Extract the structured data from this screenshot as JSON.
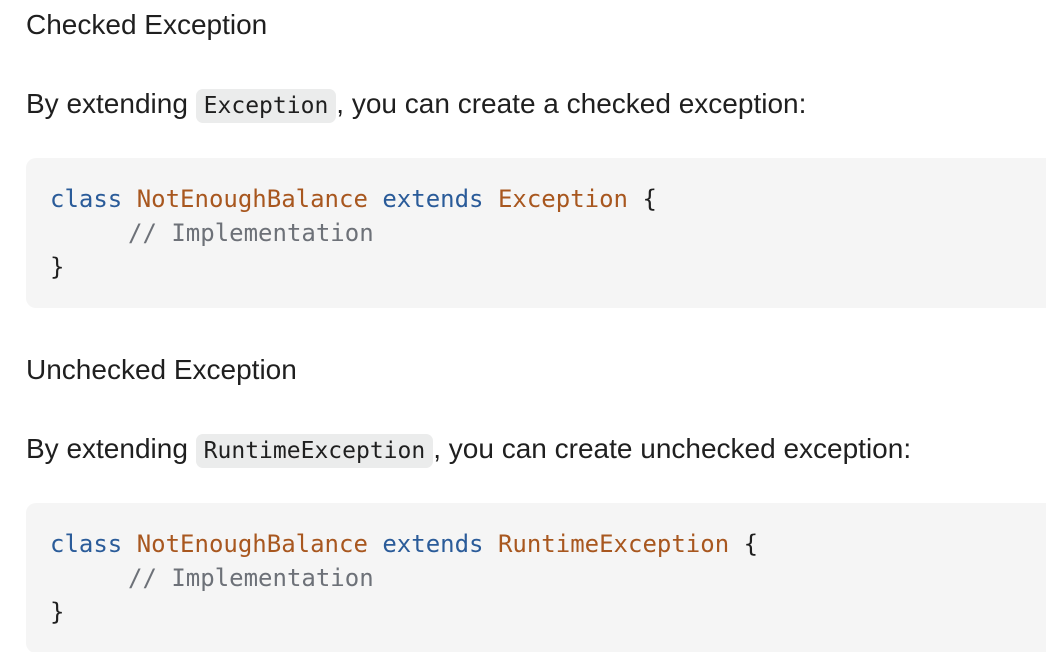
{
  "sections": [
    {
      "heading": "Checked Exception",
      "text_before": "By extending ",
      "inline_code": "Exception",
      "text_after": ", you can create a checked exception:",
      "code": {
        "kw_class": "class",
        "class_name": "NotEnoughBalance",
        "kw_extends": "extends",
        "parent": "Exception",
        "open_brace": "{",
        "comment": "// Implementation",
        "close_brace": "}"
      }
    },
    {
      "heading": "Unchecked Exception",
      "text_before": "By extending ",
      "inline_code": "RuntimeException",
      "text_after": ", you can create unchecked exception:",
      "code": {
        "kw_class": "class",
        "class_name": "NotEnoughBalance",
        "kw_extends": "extends",
        "parent": "RuntimeException",
        "open_brace": "{",
        "comment": "// Implementation",
        "close_brace": "}"
      }
    }
  ]
}
